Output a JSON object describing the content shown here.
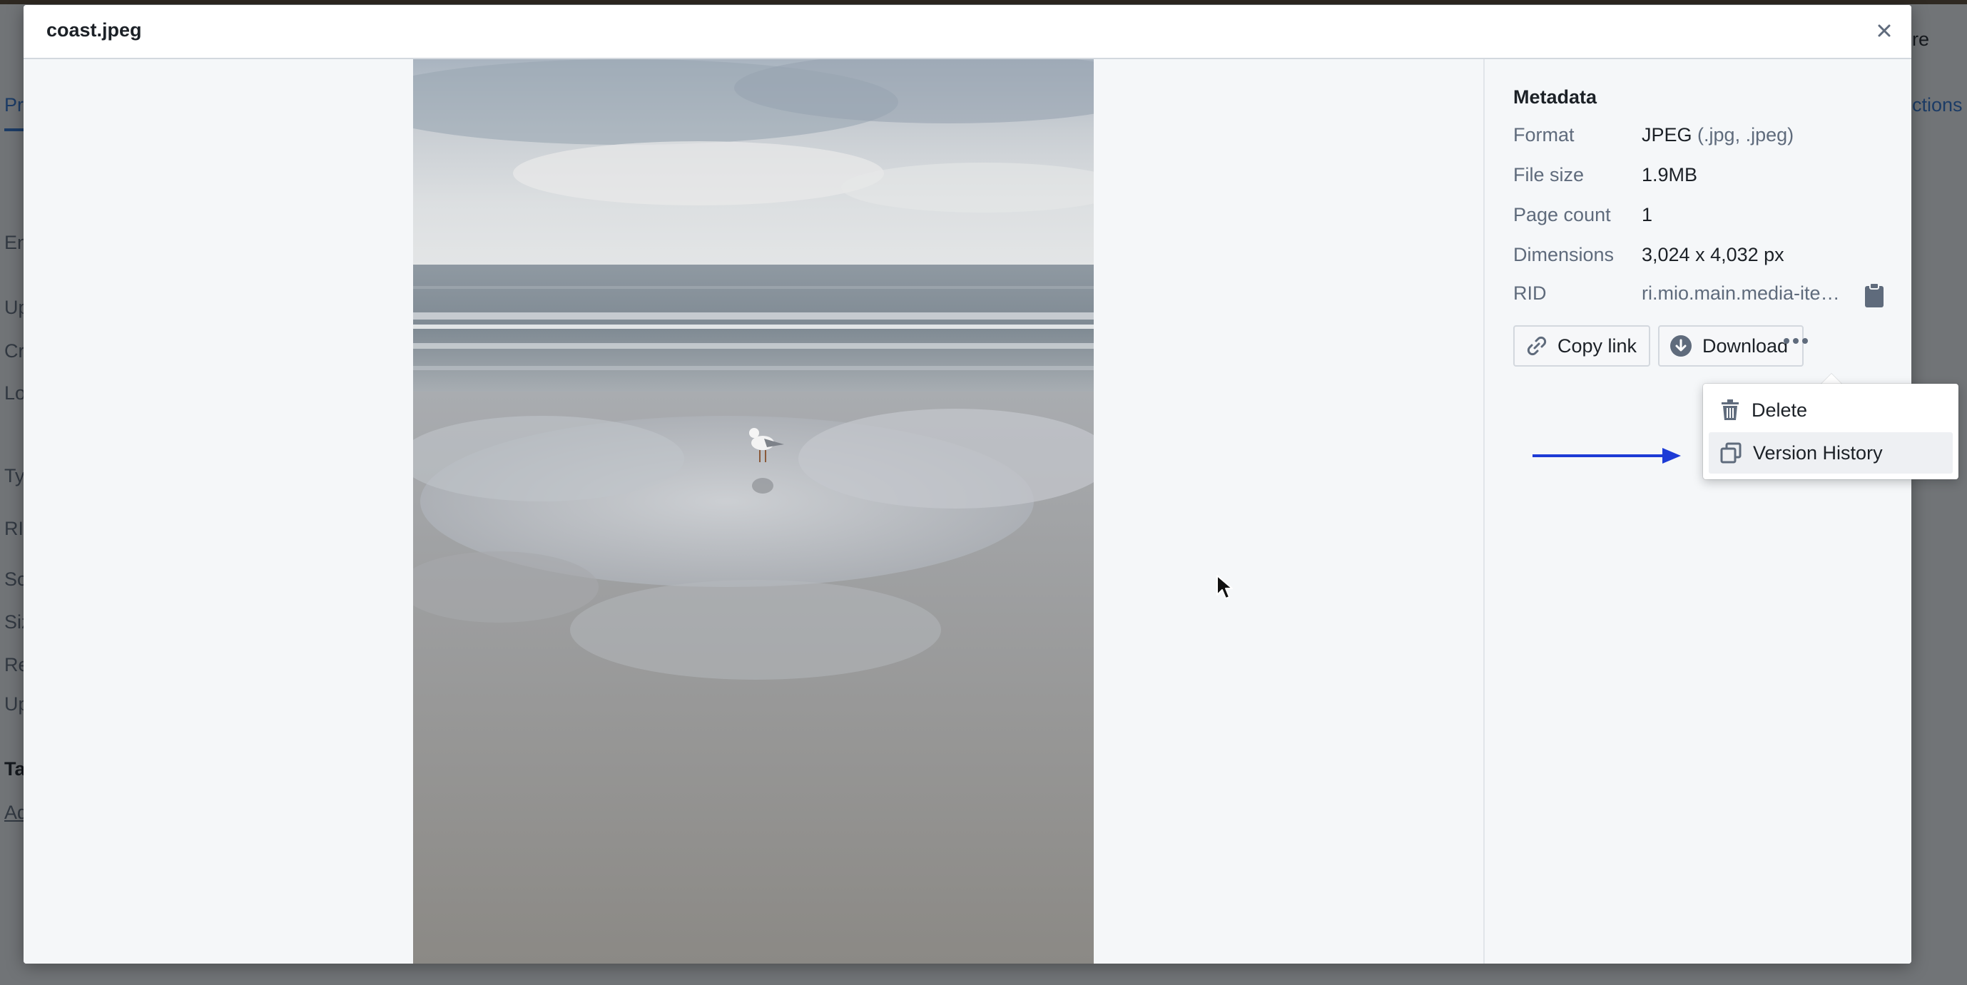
{
  "dialog": {
    "title": "coast.jpeg",
    "close_icon": "close-icon"
  },
  "metadata": {
    "title": "Metadata",
    "rows": [
      {
        "label": "Format",
        "value": "JPEG",
        "value_muted": "(.jpg, .jpeg)"
      },
      {
        "label": "File size",
        "value": "1.9MB"
      },
      {
        "label": "Page count",
        "value": "1"
      },
      {
        "label": "Dimensions",
        "value": "3,024 x 4,032 px"
      },
      {
        "label": "RID",
        "value": "ri.mio.main.media-ite…"
      }
    ],
    "clipboard_icon": "clipboard-icon"
  },
  "actions": {
    "copy_link": "Copy link",
    "download": "Download",
    "more_icon": "more-horizontal-icon"
  },
  "menu": {
    "items": [
      {
        "label": "Delete",
        "icon": "trash-icon"
      },
      {
        "label": "Version History",
        "icon": "versions-icon",
        "highlighted": true
      }
    ]
  },
  "colors": {
    "accent": "#1d3bd6",
    "panel_bg": "#f5f7f9"
  }
}
